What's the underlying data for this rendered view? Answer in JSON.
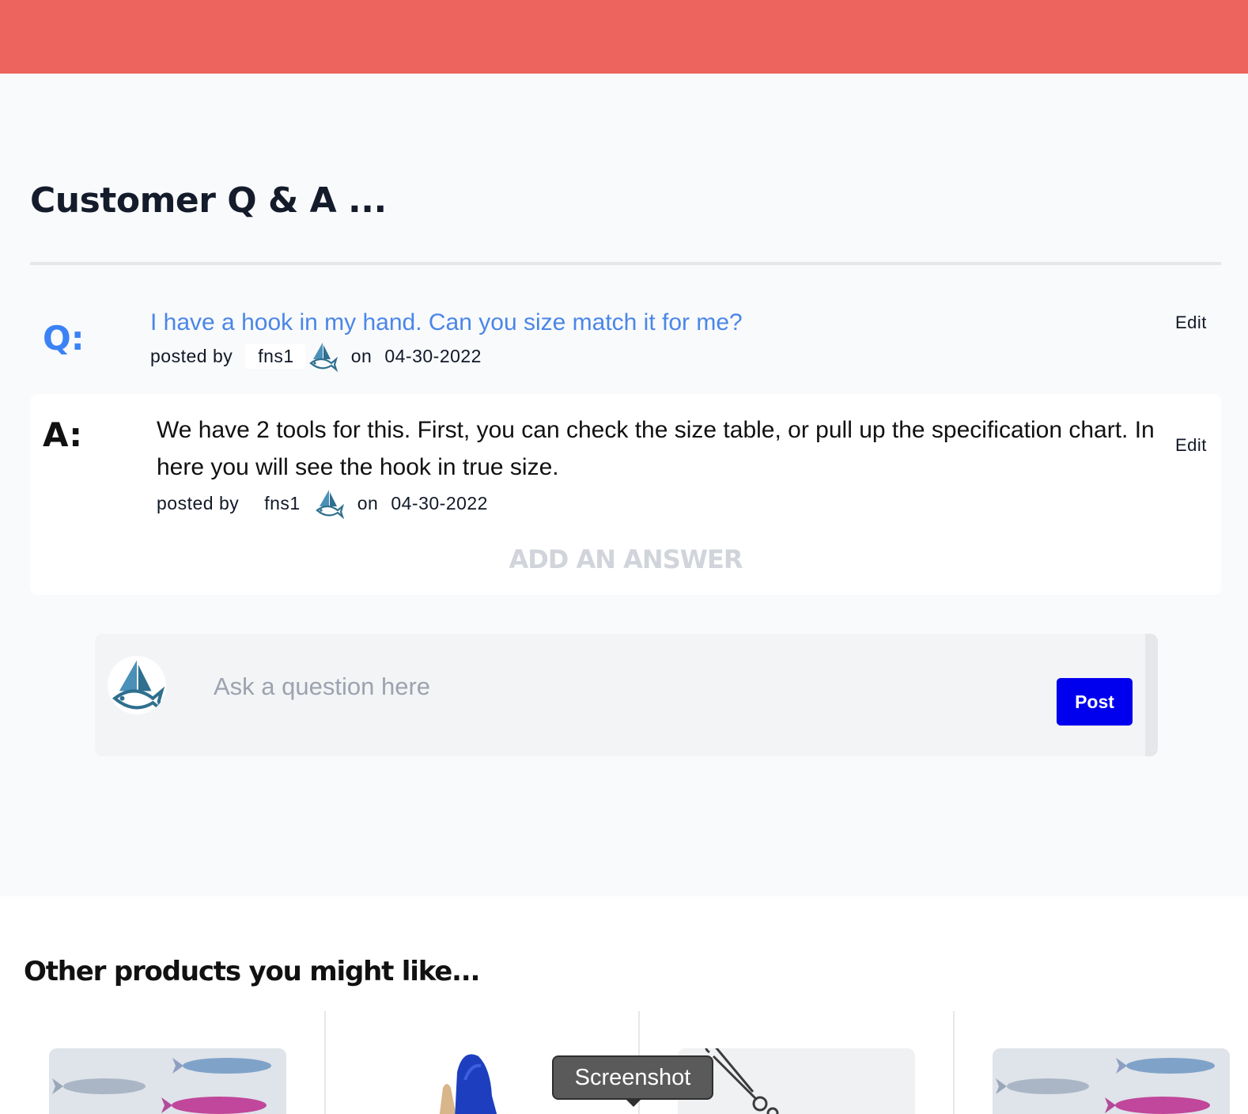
{
  "header": {
    "color": "#ed645e"
  },
  "qa": {
    "title": "Customer Q & A ...",
    "question": {
      "label": "Q:",
      "text": "I have a hook in my hand. Can you size match it for me?",
      "posted_by_label": "posted by",
      "user": "fns1",
      "on_label": "on",
      "date": "04-30-2022",
      "edit_label": "Edit"
    },
    "answer": {
      "label": "A:",
      "text": "We have 2 tools for this. First, you can check the size table, or pull up the specification chart. In here you will see the hook in true size.",
      "posted_by_label": "posted by",
      "user": "fns1",
      "on_label": "on",
      "date": "04-30-2022",
      "edit_label": "Edit"
    },
    "add_answer_label": "ADD AN ANSWER",
    "ask": {
      "placeholder": "Ask a question here",
      "value": "",
      "post_label": "Post"
    }
  },
  "other_products": {
    "title": "Other products you might like..."
  },
  "tooltip": {
    "text": "Screenshot"
  },
  "colors": {
    "accent_blue": "#0000ee",
    "link_blue": "#4a86e8",
    "brand_red": "#ed645e"
  }
}
